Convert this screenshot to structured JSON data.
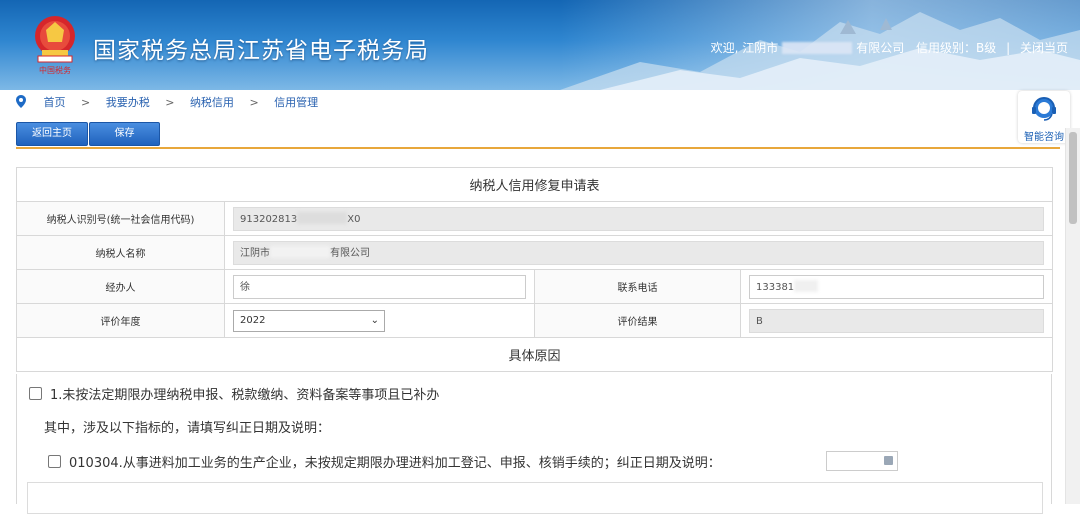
{
  "header": {
    "site_title": "国家税务总局江苏省电子税务局",
    "welcome": "欢迎, 江阴市",
    "company_suffix": "有限公司",
    "credit_level": "信用级别：B级",
    "separator": "|",
    "close_page": "关闭当页"
  },
  "breadcrumb": {
    "items": [
      "首页",
      "我要办税",
      "纳税信用",
      "信用管理"
    ],
    "arrow": ">"
  },
  "assistant": {
    "label": "智能咨询"
  },
  "toolbar": {
    "back_label": "返回主页",
    "save_label": "保存"
  },
  "form": {
    "title": "纳税人信用修复申请表",
    "taxpayer_id_label": "纳税人识别号(统一社会信用代码)",
    "taxpayer_id_prefix": "913202813",
    "taxpayer_id_suffix": "X0",
    "taxpayer_name_label": "纳税人名称",
    "taxpayer_name_prefix": "江阴市",
    "taxpayer_name_suffix": "有限公司",
    "agent_label": "经办人",
    "agent_value": "徐",
    "phone_label": "联系电话",
    "phone_value": "133381",
    "year_label": "评价年度",
    "year_value": "2022",
    "result_label": "评价结果",
    "result_value": "B"
  },
  "reasons": {
    "heading": "具体原因",
    "reason_1": "1.未按法定期限办理纳税申报、税款缴纳、资料备案等事项且已补办",
    "instruction": "其中，涉及以下指标的，请填写纠正日期及说明：",
    "indicator": "010304.从事进料加工业务的生产企业，未按规定期限办理进料加工登记、申报、核销手续的；纠正日期及说明："
  },
  "colors": {
    "header_blue": "#1466b4",
    "button_blue": "#1f62bd",
    "accent_line": "#e8a73b"
  }
}
